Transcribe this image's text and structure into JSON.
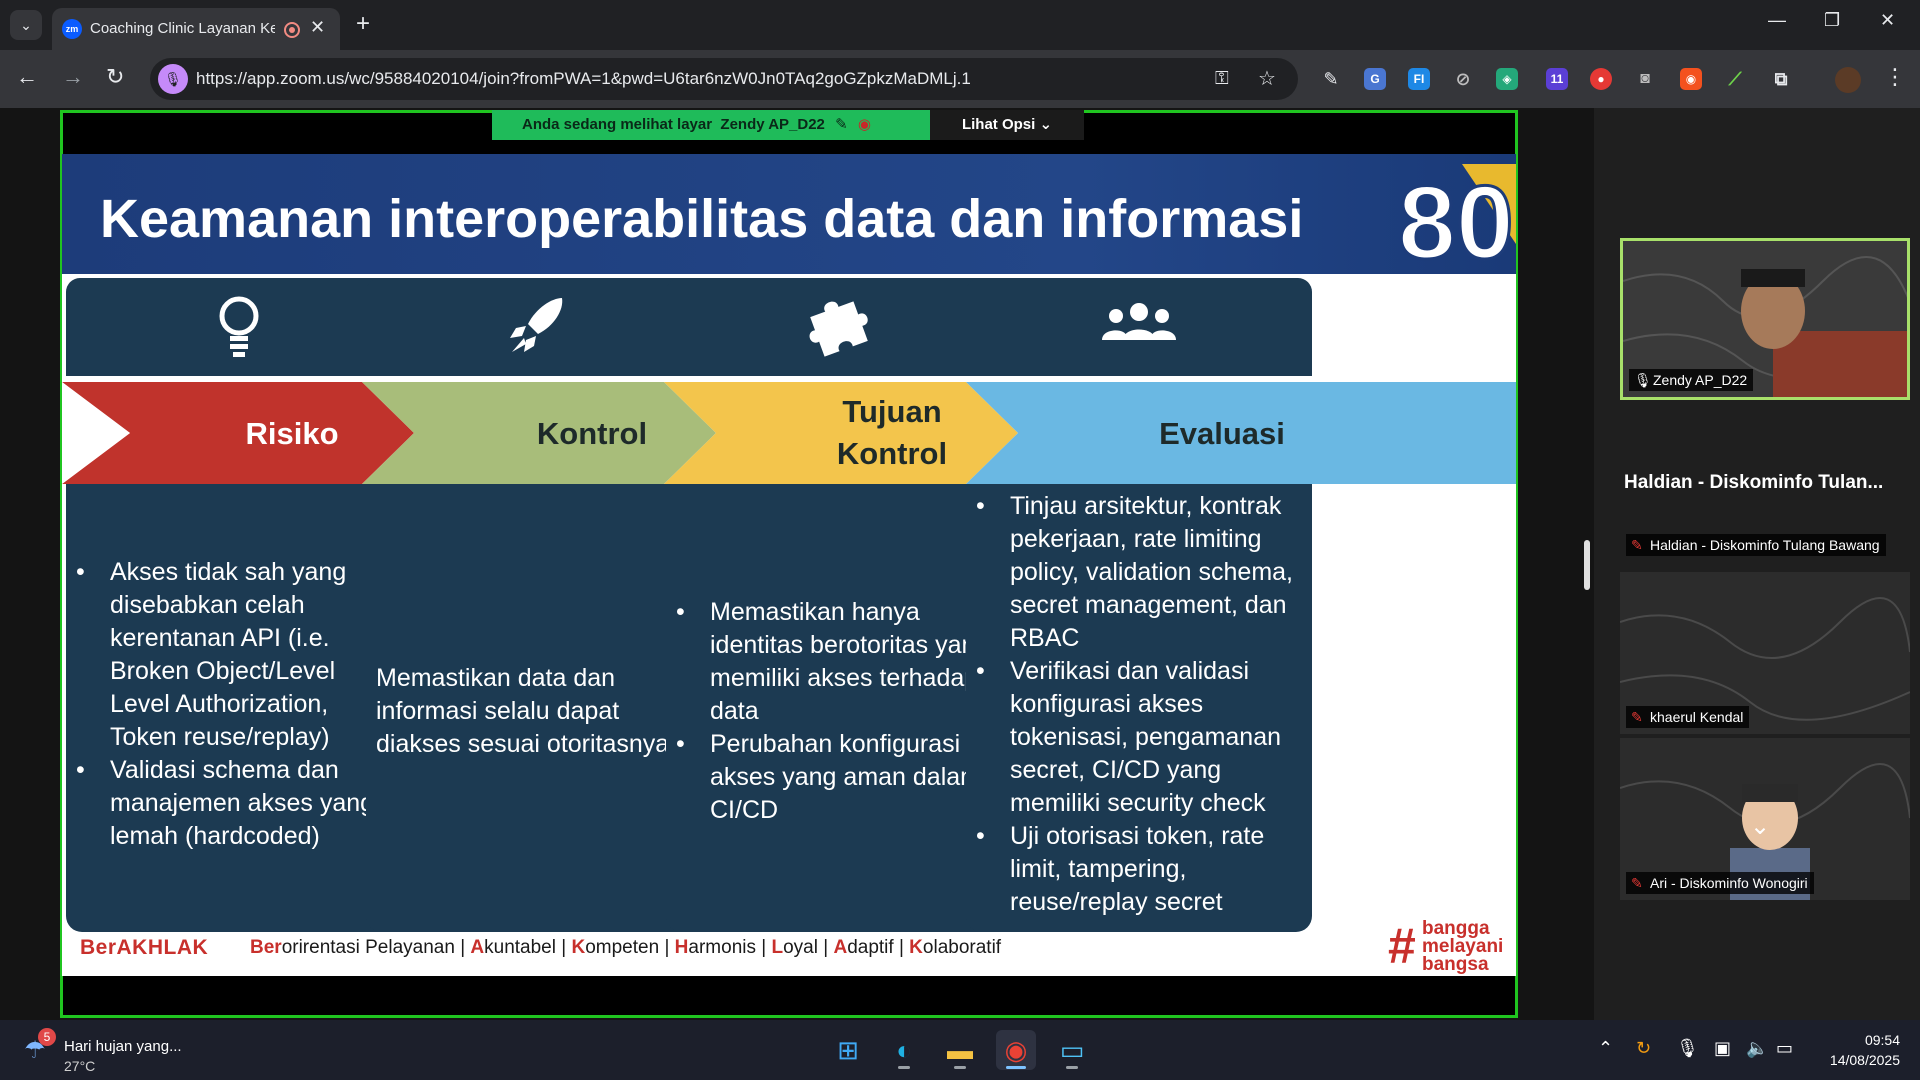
{
  "browser": {
    "tab_title": "Coaching Clinic Layanan Ke",
    "new_tab_symbol": "+",
    "url": "https://app.zoom.us/wc/95884020104/join?fromPWA=1&pwd=U6tar6nzW0Jn0TAq2goGZpkzMaDMLj.1",
    "window_controls": [
      "—",
      "❐",
      "✕"
    ]
  },
  "zoom": {
    "share_banner_prefix": "Anda sedang melihat layar",
    "share_banner_name": "Zendy AP_D22",
    "view_options_label": "Lihat Opsi"
  },
  "slide": {
    "title": "Keamanan interoperabilitas data dan informasi",
    "logo_text": "80",
    "columns": [
      {
        "heading": "Risiko",
        "icon": "lightbulb-icon",
        "color": "#c0332c",
        "bullets": [
          "Akses tidak sah yang disebabkan celah kerentanan API (i.e. Broken Object/Level Level Authorization, Token reuse/replay)",
          "Validasi schema dan manajemen akses yang lemah (hardcoded)"
        ]
      },
      {
        "heading": "Kontrol",
        "icon": "rocket-icon",
        "color": "#a8bd7a",
        "text": "Memastikan data dan informasi selalu dapat diakses sesuai otoritasnya."
      },
      {
        "heading_line1": "Tujuan",
        "heading_line2": "Kontrol",
        "icon": "puzzle-icon",
        "color": "#f3c54c",
        "bullets": [
          "Memastikan hanya identitas berotoritas yang memiliki akses terhadap data",
          "Perubahan konfigurasi akses yang aman dalam CI/CD"
        ]
      },
      {
        "heading": "Evaluasi",
        "icon": "people-icon",
        "color": "#6ab8e3",
        "bullets": [
          "Tinjau arsitektur, kontrak pekerjaan, rate limiting policy, validation schema, secret management, dan RBAC",
          "Verifikasi dan validasi konfigurasi akses tokenisasi, pengamanan secret, CI/CD yang memiliki security check",
          "Uji otorisasi token, rate limit, tampering, reuse/replay secret"
        ]
      }
    ],
    "footer": {
      "brand": "BerAKHLAK",
      "values": [
        {
          "cap": "Ber",
          "rest": "orirentasi Pelayanan"
        },
        {
          "cap": "A",
          "rest": "kuntabel"
        },
        {
          "cap": "K",
          "rest": "ompeten"
        },
        {
          "cap": "H",
          "rest": "armonis"
        },
        {
          "cap": "L",
          "rest": "oyal"
        },
        {
          "cap": "A",
          "rest": "daptif"
        },
        {
          "cap": "K",
          "rest": "olaboratif"
        }
      ],
      "separator": "|",
      "tagline": [
        "bangga",
        "melayani",
        "bangsa"
      ]
    }
  },
  "participants": {
    "tiles": [
      {
        "name": "Zendy AP_D22",
        "muted": false,
        "active": true
      },
      {
        "name": "Haldian - Diskominfo Tulang Bawang",
        "muted": true
      },
      {
        "name": "khaerul Kendal",
        "muted": true
      },
      {
        "name": "Ari - Diskominfo Wonogiri",
        "muted": true
      }
    ],
    "speaker_big_name": "Haldian - Diskominfo Tulan..."
  },
  "taskbar": {
    "weather_badge": "5",
    "weather_text": "Hari hujan yang...",
    "temperature": "27°C",
    "time": "09:54",
    "date": "14/08/2025"
  },
  "colors": {
    "share_border": "#20c520",
    "banner_green": "#1fbb5a",
    "slide_navy": "#1c3a52",
    "header_blue": "#234688",
    "brand_red": "#c8302c"
  }
}
